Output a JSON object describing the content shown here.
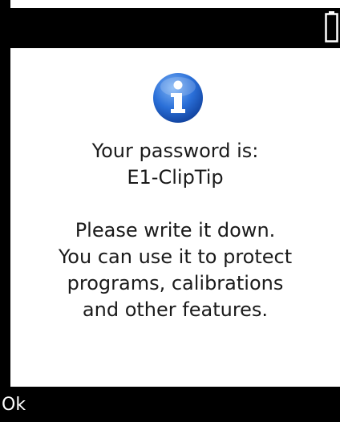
{
  "status_bar": {
    "battery_icon": "battery-icon"
  },
  "dialog": {
    "icon": "info-icon",
    "line1": "Your password is:",
    "line2": "E1-ClipTip",
    "line3": "Please write it down.",
    "line4": "You can use it to protect",
    "line5": "programs, calibrations",
    "line6": "and other features."
  },
  "softkeys": {
    "left_label": "Ok"
  },
  "colors": {
    "bar": "#000000",
    "background": "#ffffff",
    "info_blue": "#1e63d6"
  }
}
